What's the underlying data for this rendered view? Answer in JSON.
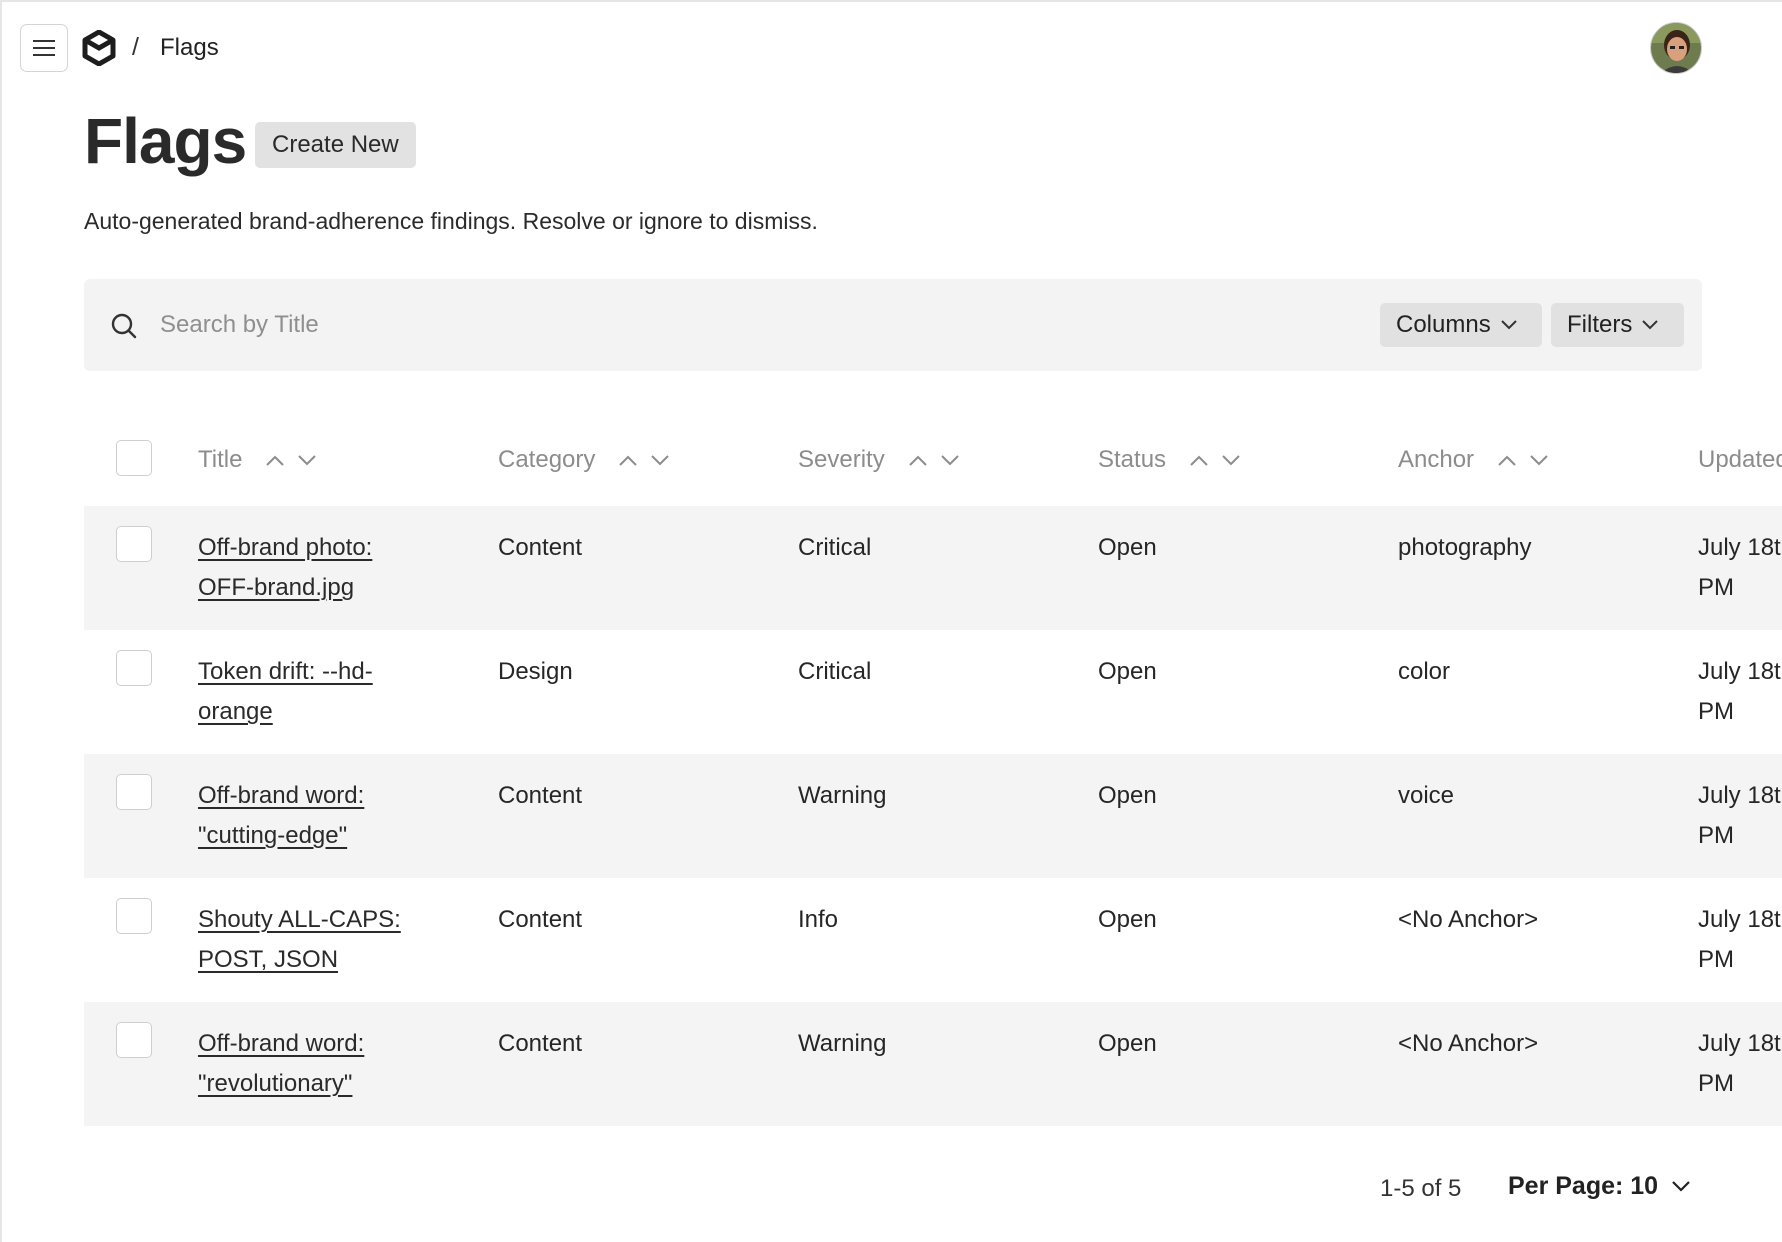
{
  "header": {
    "breadcrumb_separator": "/",
    "breadcrumb_current": "Flags"
  },
  "page": {
    "title": "Flags",
    "create_button": "Create New",
    "subtitle": "Auto-generated brand-adherence findings. Resolve or ignore to dismiss."
  },
  "search": {
    "placeholder": "Search by Title",
    "value": "",
    "columns_label": "Columns",
    "filters_label": "Filters"
  },
  "table": {
    "columns": [
      "Title",
      "Category",
      "Severity",
      "Status",
      "Anchor",
      "Updated"
    ],
    "rows": [
      {
        "title": "Off-brand photo: OFF-brand.jpg",
        "category": "Content",
        "severity": "Critical",
        "status": "Open",
        "anchor": "photography",
        "updated": "July 18t PM"
      },
      {
        "title": "Token drift: --hd-orange",
        "category": "Design",
        "severity": "Critical",
        "status": "Open",
        "anchor": "color",
        "updated": "July 18t PM"
      },
      {
        "title": "Off-brand word: \"cutting-edge\"",
        "category": "Content",
        "severity": "Warning",
        "status": "Open",
        "anchor": "voice",
        "updated": "July 18t PM"
      },
      {
        "title": "Shouty ALL-CAPS: POST, JSON",
        "category": "Content",
        "severity": "Info",
        "status": "Open",
        "anchor": "<No Anchor>",
        "updated": "July 18t PM"
      },
      {
        "title": "Off-brand word: \"revolutionary\"",
        "category": "Content",
        "severity": "Warning",
        "status": "Open",
        "anchor": "<No Anchor>",
        "updated": "July 18t PM"
      }
    ]
  },
  "pagination": {
    "range": "1-5 of 5",
    "per_page": "Per Page: 10"
  },
  "icons": {
    "menu": "hamburger-icon",
    "logo": "brand-logo-icon",
    "search": "search-icon",
    "sort_up": "chevron-up-icon",
    "sort_down": "chevron-down-icon"
  }
}
